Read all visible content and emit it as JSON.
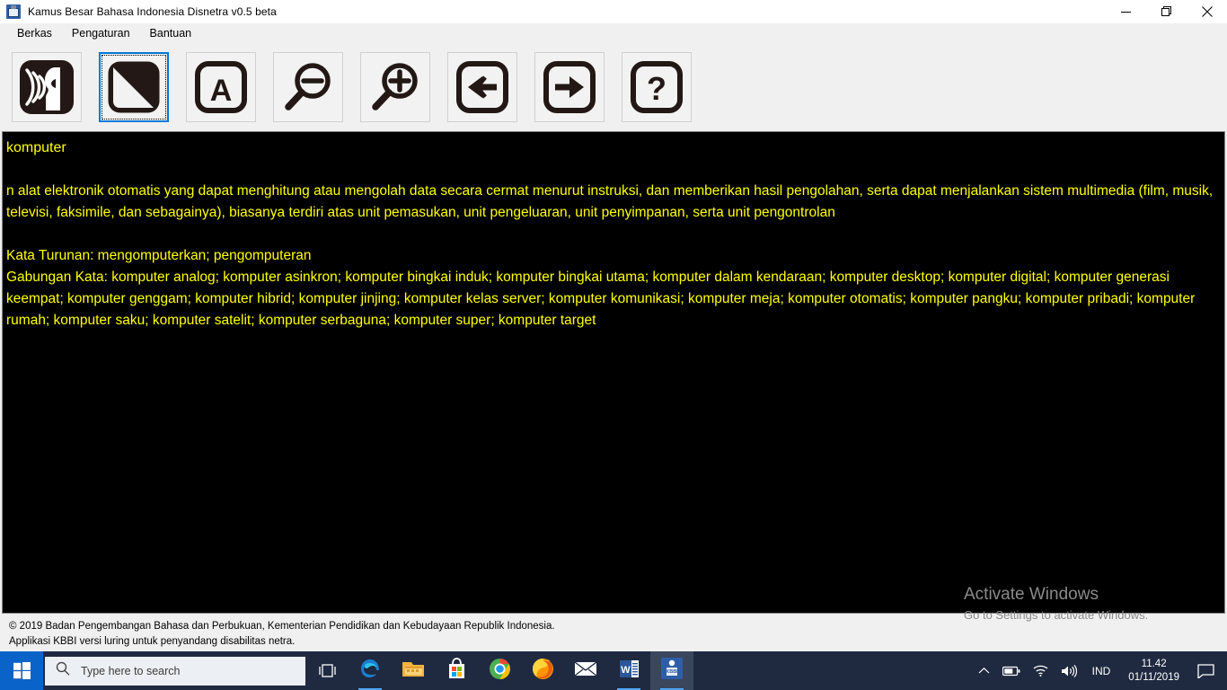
{
  "window": {
    "title": "Kamus Besar Bahasa Indonesia Disnetra v0.5 beta",
    "app_icon": "kbbi-book-icon",
    "controls": {
      "minimize": "minimize-icon",
      "restore": "restore-icon",
      "close": "close-icon"
    }
  },
  "menubar": {
    "items": [
      {
        "label": "Berkas"
      },
      {
        "label": "Pengaturan"
      },
      {
        "label": "Bantuan"
      }
    ]
  },
  "toolbar": {
    "buttons": [
      {
        "name": "speech-icon",
        "title": "Baca / Suara",
        "focused": false
      },
      {
        "name": "contrast-icon",
        "title": "Kontras",
        "focused": true
      },
      {
        "name": "font-a-icon",
        "title": "Huruf",
        "focused": false
      },
      {
        "name": "zoom-out-icon",
        "title": "Perkecil",
        "focused": false
      },
      {
        "name": "zoom-in-icon",
        "title": "Perbesar",
        "focused": false
      },
      {
        "name": "arrow-left-icon",
        "title": "Mundur",
        "focused": false
      },
      {
        "name": "arrow-right-icon",
        "title": "Maju",
        "focused": false
      },
      {
        "name": "help-question-icon",
        "title": "Bantuan",
        "focused": false
      }
    ]
  },
  "content": {
    "entry_word": "komputer",
    "definition": "n alat elektronik otomatis yang dapat menghitung atau mengolah data secara cermat menurut instruksi, dan memberikan hasil pengolahan, serta dapat menjalankan sistem multimedia (film, musik, televisi, faksimile, dan sebagainya), biasanya terdiri atas unit pemasukan, unit pengeluaran, unit penyimpanan, serta unit pengontrolan",
    "kata_turunan": "Kata Turunan: mengomputerkan; pengomputeran",
    "gabungan_kata": "Gabungan Kata: komputer analog; komputer asinkron; komputer bingkai induk; komputer bingkai utama; komputer dalam kendaraan; komputer desktop; komputer digital; komputer generasi keempat; komputer genggam; komputer hibrid; komputer jinjing; komputer kelas server; komputer komunikasi; komputer meja; komputer otomatis; komputer pangku; komputer pribadi; komputer rumah; komputer saku; komputer satelit; komputer serbaguna; komputer super; komputer target",
    "text_color": "#ffff00",
    "background_color": "#000000"
  },
  "statusbar": {
    "line1": "© 2019 Badan Pengembangan Bahasa dan Perbukuan, Kementerian Pendidikan dan Kebudayaan Republik Indonesia.",
    "line2": "Applikasi KBBI versi luring untuk penyandang disabilitas netra."
  },
  "watermark": {
    "title": "Activate Windows",
    "subtitle": "Go to Settings to activate Windows."
  },
  "taskbar": {
    "start": "windows-start-icon",
    "search_placeholder": "Type here to search",
    "search_icon": "search-icon",
    "task_view": "task-view-icon",
    "apps": [
      {
        "name": "edge-icon",
        "label": "Microsoft Edge",
        "active": false,
        "running": true
      },
      {
        "name": "file-explorer-icon",
        "label": "File Explorer",
        "active": false,
        "running": false
      },
      {
        "name": "microsoft-store-icon",
        "label": "Microsoft Store",
        "active": false,
        "running": false
      },
      {
        "name": "chrome-icon",
        "label": "Google Chrome",
        "active": false,
        "running": false
      },
      {
        "name": "firefox-icon",
        "label": "Mozilla Firefox",
        "active": false,
        "running": false
      },
      {
        "name": "mail-icon",
        "label": "Mail",
        "active": false,
        "running": false
      },
      {
        "name": "word-icon",
        "label": "Microsoft Word",
        "active": false,
        "running": true
      },
      {
        "name": "kbbi-icon",
        "label": "KBBI",
        "active": true,
        "running": true
      }
    ],
    "tray": {
      "chevron": "chevron-up-icon",
      "battery": "battery-icon",
      "wifi": "wifi-icon",
      "volume": "volume-icon",
      "language": "IND",
      "time": "11.42",
      "date": "01/11/2019",
      "notification": "notification-icon"
    },
    "accent_color": "#0a63c9",
    "background_color": "#1f2a40"
  }
}
